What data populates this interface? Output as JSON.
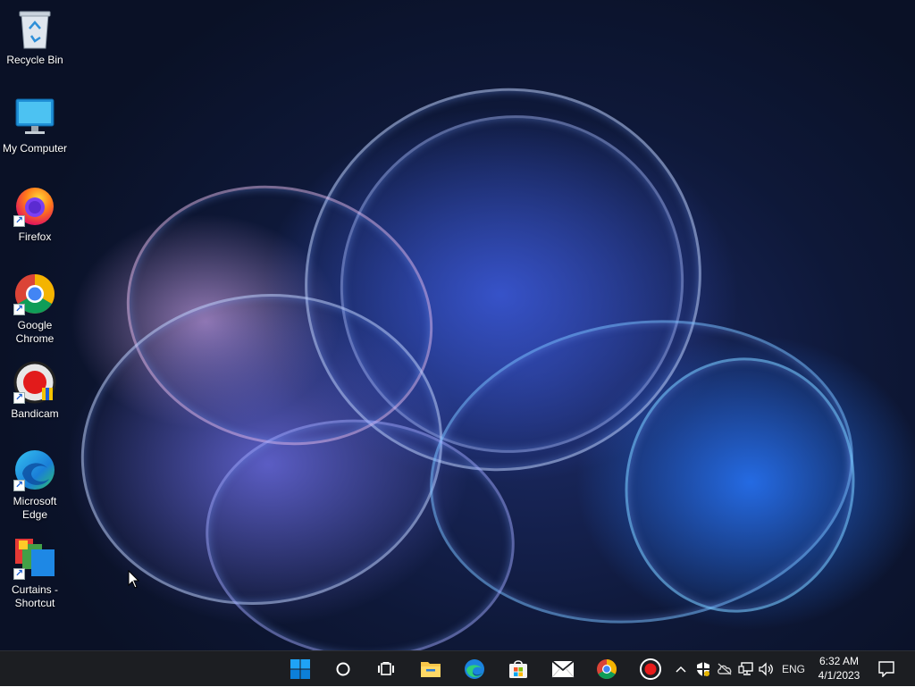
{
  "desktop": {
    "icons": [
      {
        "label": "Recycle Bin",
        "icon": "recycle-bin-icon",
        "shortcut": false
      },
      {
        "label": "My Computer",
        "icon": "monitor-icon",
        "shortcut": false
      },
      {
        "label": "Firefox",
        "icon": "firefox-icon",
        "shortcut": true
      },
      {
        "label": "Google Chrome",
        "icon": "chrome-icon",
        "shortcut": true
      },
      {
        "label": "Bandicam",
        "icon": "bandicam-icon",
        "shortcut": true
      },
      {
        "label": "Microsoft Edge",
        "icon": "edge-icon",
        "shortcut": true
      },
      {
        "label": "Curtains - Shortcut",
        "icon": "curtains-icon",
        "shortcut": true
      }
    ]
  },
  "taskbar": {
    "apps": [
      {
        "name": "Start",
        "icon": "windows-logo-icon"
      },
      {
        "name": "Search",
        "icon": "search-circle-icon"
      },
      {
        "name": "Task View",
        "icon": "task-view-icon"
      },
      {
        "name": "File Explorer",
        "icon": "folder-icon"
      },
      {
        "name": "Microsoft Edge",
        "icon": "edge-icon"
      },
      {
        "name": "Microsoft Store",
        "icon": "store-icon"
      },
      {
        "name": "Mail",
        "icon": "mail-icon"
      },
      {
        "name": "Google Chrome",
        "icon": "chrome-icon"
      },
      {
        "name": "Bandicam",
        "icon": "record-icon"
      }
    ],
    "tray": {
      "language": "ENG",
      "time": "6:32 AM",
      "date": "4/1/2023"
    }
  },
  "colors": {
    "taskbar_bg": "#1c1e22",
    "accent": "#0a84ff"
  }
}
